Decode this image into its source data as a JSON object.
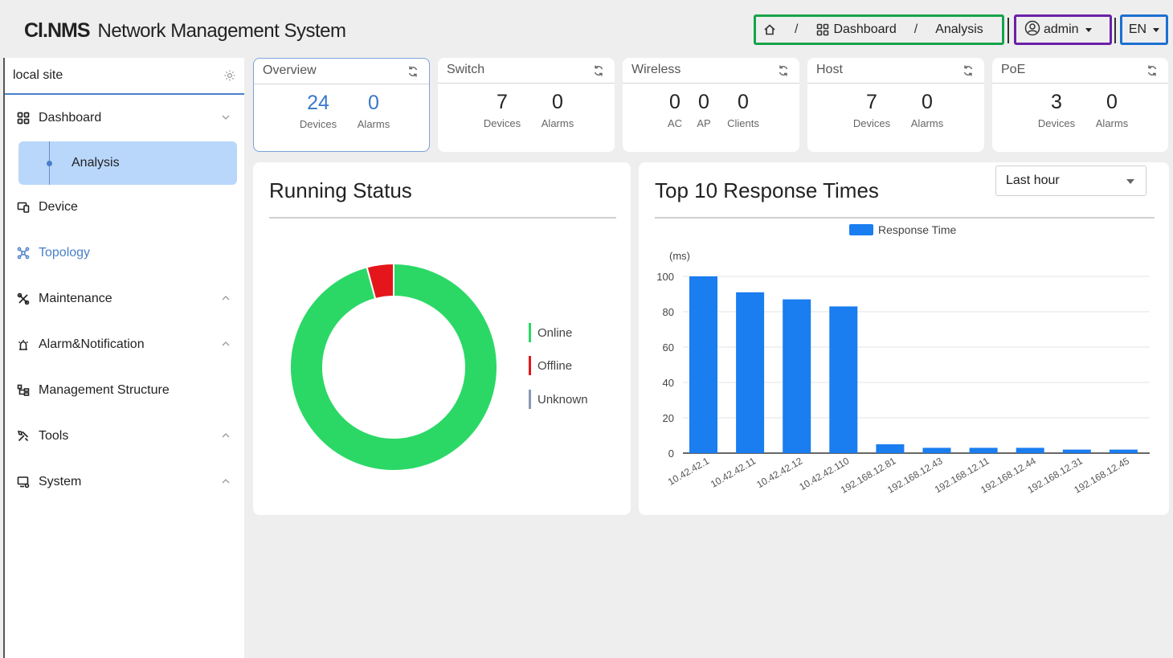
{
  "header": {
    "logo": "Cl.NMS",
    "title": "Network Management System",
    "breadcrumb": {
      "home_icon": "home-icon",
      "dashboard": "Dashboard",
      "current": "Analysis",
      "separator": "/"
    },
    "user": "admin",
    "language": "EN"
  },
  "sidebar": {
    "site": "local site",
    "items": [
      {
        "label": "Dashboard",
        "icon": "grid-icon"
      },
      {
        "label": "Analysis"
      },
      {
        "label": "Device",
        "icon": "device-icon"
      },
      {
        "label": "Topology",
        "icon": "topology-icon"
      },
      {
        "label": "Maintenance",
        "icon": "wrench-icon"
      },
      {
        "label": "Alarm&Notification",
        "icon": "bell-icon"
      },
      {
        "label": "Management Structure",
        "icon": "structure-icon"
      },
      {
        "label": "Tools",
        "icon": "tools-icon"
      },
      {
        "label": "System",
        "icon": "system-icon"
      }
    ]
  },
  "cards": [
    {
      "title": "Overview",
      "stats": [
        {
          "value": "24",
          "label": "Devices"
        },
        {
          "value": "0",
          "label": "Alarms"
        }
      ]
    },
    {
      "title": "Switch",
      "stats": [
        {
          "value": "7",
          "label": "Devices"
        },
        {
          "value": "0",
          "label": "Alarms"
        }
      ]
    },
    {
      "title": "Wireless",
      "stats": [
        {
          "value": "0",
          "label": "AC"
        },
        {
          "value": "0",
          "label": "AP"
        },
        {
          "value": "0",
          "label": "Clients"
        }
      ]
    },
    {
      "title": "Host",
      "stats": [
        {
          "value": "7",
          "label": "Devices"
        },
        {
          "value": "0",
          "label": "Alarms"
        }
      ]
    },
    {
      "title": "PoE",
      "stats": [
        {
          "value": "3",
          "label": "Devices"
        },
        {
          "value": "0",
          "label": "Alarms"
        }
      ]
    }
  ],
  "running_status": {
    "title": "Running Status",
    "legend": [
      "Online",
      "Offline",
      "Unknown"
    ],
    "colors": {
      "online": "#2bd866",
      "offline": "#e5161b",
      "unknown": "#8a9ab0"
    }
  },
  "response_panel": {
    "title": "Top 10 Response Times",
    "range_select": "Last hour"
  },
  "chart_data": [
    {
      "type": "pie",
      "title": "Running Status",
      "labels": [
        "Online",
        "Offline",
        "Unknown"
      ],
      "values": [
        23,
        1,
        0
      ],
      "colors": [
        "#2bd866",
        "#e5161b",
        "#8a9ab0"
      ]
    },
    {
      "type": "bar",
      "title": "Top 10 Response Times",
      "series": [
        {
          "name": "Response Time",
          "values": [
            100,
            91,
            87,
            83,
            5,
            3,
            3,
            3,
            2,
            2
          ]
        }
      ],
      "categories": [
        "10.42.42.1",
        "10.42.42.11",
        "10.42.42.12",
        "10.42.42.110",
        "192.168.12.81",
        "192.168.12.43",
        "192.168.12.11",
        "192.168.12.44",
        "192.168.12.31",
        "192.168.12.45"
      ],
      "ylabel": "(ms)",
      "ylim": [
        0,
        100
      ],
      "yticks": [
        0,
        20,
        40,
        60,
        80,
        100
      ],
      "color": "#1a7df0",
      "legend": "top"
    }
  ]
}
